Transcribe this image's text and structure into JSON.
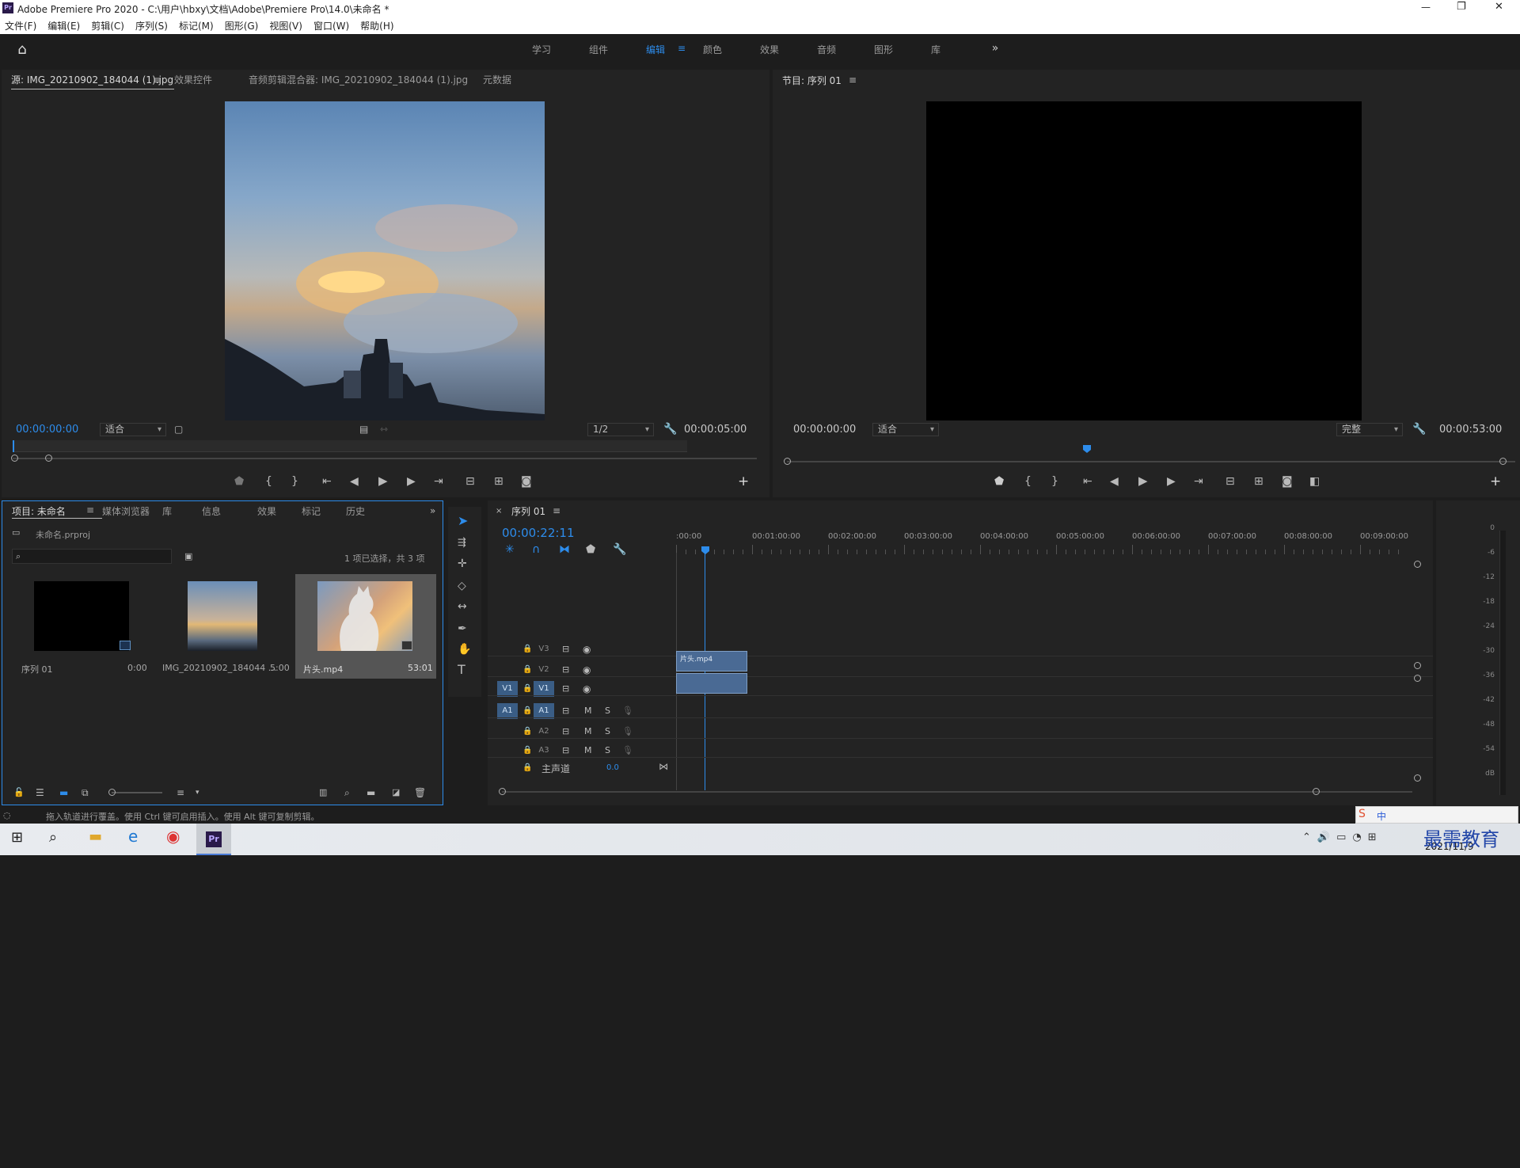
{
  "window": {
    "title": "Adobe Premiere Pro 2020 - C:\\用户\\hbxy\\文档\\Adobe\\Premiere Pro\\14.0\\未命名 *",
    "app_icon": "Pr",
    "min": "—",
    "max": "❐",
    "close": "✕"
  },
  "menu": [
    "文件(F)",
    "编辑(E)",
    "剪辑(C)",
    "序列(S)",
    "标记(M)",
    "图形(G)",
    "视图(V)",
    "窗口(W)",
    "帮助(H)"
  ],
  "workspaces": {
    "items": [
      "学习",
      "组件",
      "编辑",
      "颜色",
      "效果",
      "音频",
      "图形",
      "库"
    ],
    "active": "编辑",
    "overflow": "»"
  },
  "source_panel": {
    "tabs": [
      "源: IMG_20210902_184044 (1).jpg",
      "效果控件",
      "音频剪辑混合器: IMG_20210902_184044 (1).jpg",
      "元数据"
    ],
    "timecode_in": "00:00:00:00",
    "zoom": "适合",
    "resolution": "1/2",
    "duration": "00:00:05:00"
  },
  "program_panel": {
    "title": "节目: 序列 01",
    "timecode_in": "00:00:00:00",
    "zoom": "适合",
    "quality": "完整",
    "duration": "00:00:53:00"
  },
  "project_panel": {
    "tabs": [
      "项目: 未命名",
      "媒体浏览器",
      "库",
      "信息",
      "效果",
      "标记",
      "历史"
    ],
    "file": "未命名.prproj",
    "status": "1 项已选择，共 3 项",
    "items": [
      {
        "name": "序列 01",
        "duration": "0:00"
      },
      {
        "name": "IMG_20210902_184044 ...",
        "duration": "5:00"
      },
      {
        "name": "片头.mp4",
        "duration": "53:01"
      }
    ]
  },
  "timeline": {
    "title": "序列 01",
    "timecode": "00:00:22:11",
    "ruler": [
      ":00:00",
      "00:01:00:00",
      "00:02:00:00",
      "00:03:00:00",
      "00:04:00:00",
      "00:05:00:00",
      "00:06:00:00",
      "00:07:00:00",
      "00:08:00:00",
      "00:09:00:00"
    ],
    "video_tracks": [
      "V3",
      "V2",
      "V1"
    ],
    "audio_tracks": [
      "A1",
      "A2",
      "A3"
    ],
    "source_v": "V1",
    "source_a": "A1",
    "master": "主声道",
    "master_val": "0.0",
    "clip": "片头.mp4",
    "mute": "M",
    "solo": "S"
  },
  "meter": {
    "labels": [
      "0",
      "-6",
      "-12",
      "-18",
      "-24",
      "-30",
      "-36",
      "-42",
      "-48",
      "-54",
      "dB"
    ]
  },
  "statusbar": {
    "text": "拖入轨道进行覆盖。使用 Ctrl 键可启用插入。使用 Alt 键可复制剪辑。"
  },
  "taskbar": {
    "date": "2021/11/9",
    "watermark": "最需教育",
    "ime": "中"
  },
  "colors": {
    "accent": "#2d8ceb",
    "panel": "#232323",
    "bg": "#1d1d1d",
    "clip": "#4a6a94"
  }
}
